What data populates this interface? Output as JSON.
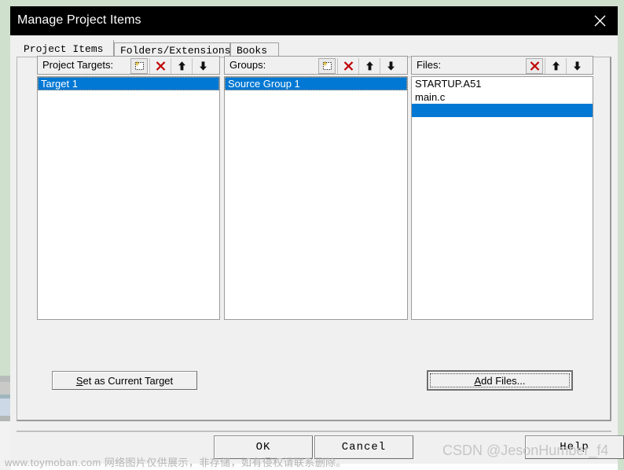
{
  "window": {
    "title": "Manage Project Items",
    "close_icon": "close-icon"
  },
  "tabs": [
    {
      "label": "Project Items",
      "active": true
    },
    {
      "label": "Folders/Extensions",
      "active": false
    },
    {
      "label": "Books",
      "active": false
    }
  ],
  "columns": {
    "targets": {
      "label": "Project Targets:",
      "icons": [
        "new-item-icon",
        "delete-icon",
        "move-up-icon",
        "move-down-icon"
      ],
      "items": [
        {
          "text": "Target 1",
          "selected": true
        }
      ]
    },
    "groups": {
      "label": "Groups:",
      "icons": [
        "new-item-icon",
        "delete-icon",
        "move-up-icon",
        "move-down-icon"
      ],
      "items": [
        {
          "text": "Source Group 1",
          "selected": true
        }
      ]
    },
    "files": {
      "label": "Files:",
      "icons": [
        "delete-icon",
        "move-up-icon",
        "move-down-icon"
      ],
      "items": [
        {
          "text": "STARTUP.A51",
          "selected": false
        },
        {
          "text": "main.c",
          "selected": false
        },
        {
          "text": "",
          "selected": true
        }
      ]
    }
  },
  "actions": {
    "set_current_target": {
      "prefix": "S",
      "rest": "et as Current Target"
    },
    "add_files": {
      "prefix": "A",
      "rest": "dd Files..."
    }
  },
  "footer": {
    "ok": "OK",
    "cancel": "Cancel",
    "help": "Help"
  },
  "watermarks": {
    "bottom": "www.toymoban.com 网络图片仅供展示，非存储，如有侵权请联系删除。",
    "csdn": "CSDN @JesonHumber_f4"
  },
  "colors": {
    "selection_blue": "#0078d4",
    "titlebar": "#000000",
    "dialog_face": "#f0f0f0",
    "delete_red": "#c00000",
    "backdrop_green": "#cfe0cd"
  }
}
